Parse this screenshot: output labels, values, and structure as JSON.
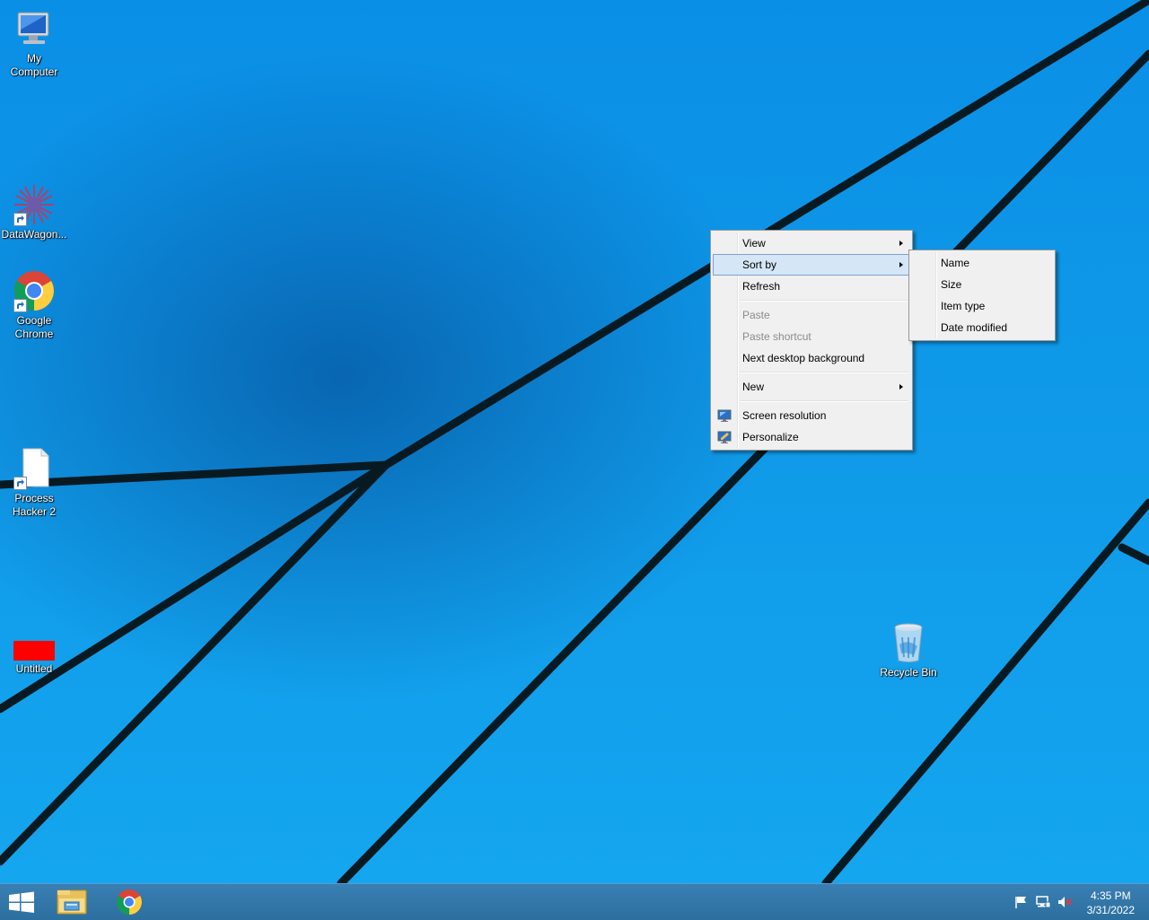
{
  "desktop": {
    "icons": [
      {
        "label": "My\nComputer",
        "icon": "computer-icon"
      },
      {
        "label": "DataWagon...",
        "icon": "datawagon-icon"
      },
      {
        "label": "Google\nChrome",
        "icon": "chrome-icon"
      },
      {
        "label": "Process\nHacker 2",
        "icon": "document-icon"
      },
      {
        "label": "Untitled",
        "icon": "red-image-icon"
      },
      {
        "label": "Recycle Bin",
        "icon": "recycle-bin-icon"
      }
    ]
  },
  "context_menu": {
    "items": {
      "view": "View",
      "sort_by": "Sort by",
      "refresh": "Refresh",
      "paste": "Paste",
      "paste_shortcut": "Paste shortcut",
      "next_background": "Next desktop background",
      "new": "New",
      "screen_resolution": "Screen resolution",
      "personalize": "Personalize"
    },
    "highlighted": "Sort by",
    "disabled": [
      "Paste",
      "Paste shortcut"
    ]
  },
  "sort_submenu": {
    "items": [
      "Name",
      "Size",
      "Item type",
      "Date modified"
    ]
  },
  "taskbar": {
    "apps": [
      "start-icon",
      "file-explorer-icon",
      "chrome-icon"
    ],
    "tray": [
      "action-center-flag-icon",
      "network-icon",
      "volume-muted-icon"
    ],
    "clock": {
      "time": "4:35 PM",
      "date": "3/31/2022"
    }
  },
  "colors": {
    "accent": "#0d8fe0",
    "menu_highlight": "#d5e6f7",
    "taskbar": "#2c6f9f"
  }
}
